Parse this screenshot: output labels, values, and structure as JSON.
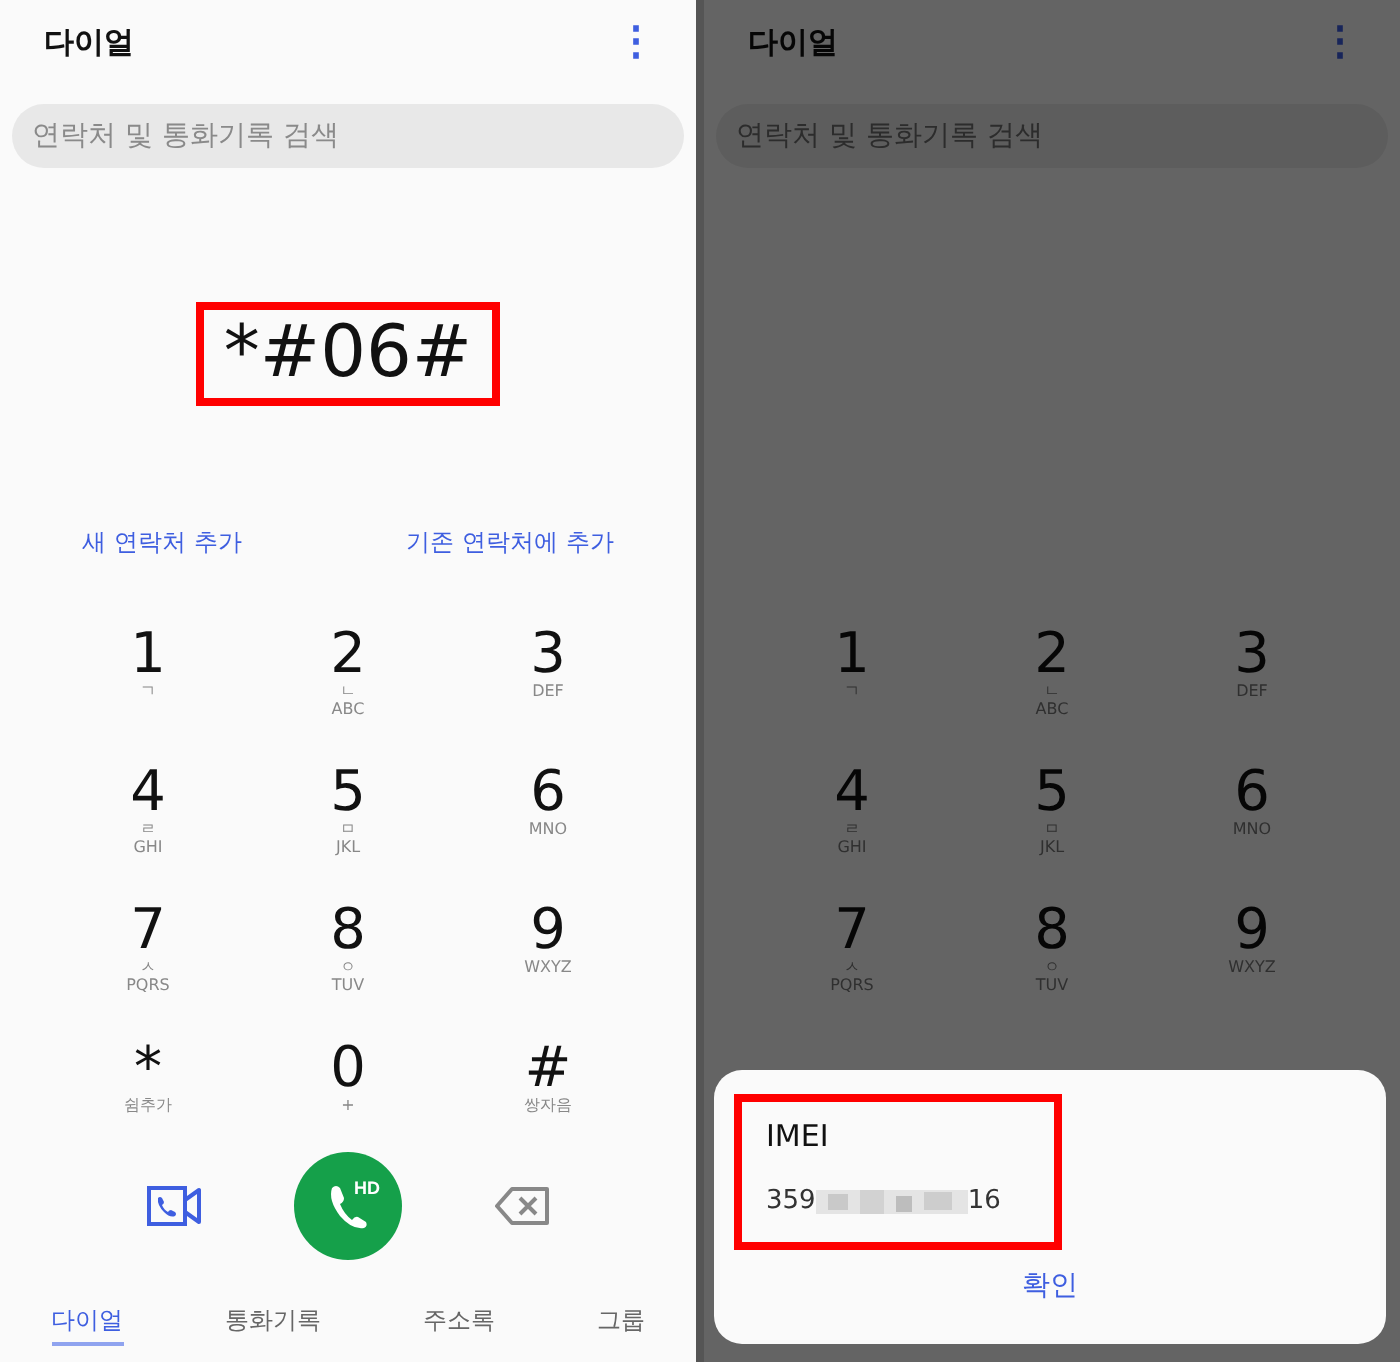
{
  "screens": [
    {
      "dimmed": false,
      "title": "다이얼",
      "menu_icon": "⋮",
      "search": {
        "placeholder": "연락처 및 통화기록 검색"
      },
      "dialed_number": {
        "text": "*#06#",
        "highlighted": true
      },
      "links": [
        "새 연락처 추가",
        "기존 연락처에 추가"
      ],
      "keypad": [
        {
          "digit": "1",
          "sub": [
            "ㄱ"
          ]
        },
        {
          "digit": "2",
          "sub": [
            "ㄴ",
            "ABC"
          ]
        },
        {
          "digit": "3",
          "sub": [
            "DEF"
          ]
        },
        {
          "digit": "4",
          "sub": [
            "ㄹ",
            "GHI"
          ]
        },
        {
          "digit": "5",
          "sub": [
            "ㅁ",
            "JKL"
          ]
        },
        {
          "digit": "6",
          "sub": [
            "MNO"
          ]
        },
        {
          "digit": "7",
          "sub": [
            "ㅅ",
            "PQRS"
          ]
        },
        {
          "digit": "8",
          "sub": [
            "ㅇ",
            "TUV"
          ]
        },
        {
          "digit": "9",
          "sub": [
            "WXYZ"
          ]
        },
        {
          "digit": "*",
          "sub": [
            "쉼추가"
          ]
        },
        {
          "digit": "0",
          "sub": [
            "+"
          ]
        },
        {
          "digit": "#",
          "sub": [
            "쌍자음"
          ]
        }
      ],
      "call_button": {
        "badge": "HD"
      },
      "tabs": [
        {
          "label": "다이얼",
          "selected": true
        },
        {
          "label": "통화기록",
          "selected": false
        },
        {
          "label": "주소록",
          "selected": false
        },
        {
          "label": "그룹",
          "selected": false
        }
      ]
    },
    {
      "dimmed": true,
      "title": "다이얼",
      "menu_icon": "⋮",
      "search": {
        "placeholder": "연락처 및 통화기록 검색"
      },
      "keypad": [
        {
          "digit": "1",
          "sub": [
            "ㄱ"
          ]
        },
        {
          "digit": "2",
          "sub": [
            "ㄴ",
            "ABC"
          ]
        },
        {
          "digit": "3",
          "sub": [
            "DEF"
          ]
        },
        {
          "digit": "4",
          "sub": [
            "ㄹ",
            "GHI"
          ]
        },
        {
          "digit": "5",
          "sub": [
            "ㅁ",
            "JKL"
          ]
        },
        {
          "digit": "6",
          "sub": [
            "MNO"
          ]
        },
        {
          "digit": "7",
          "sub": [
            "ㅅ",
            "PQRS"
          ]
        },
        {
          "digit": "8",
          "sub": [
            "ㅇ",
            "TUV"
          ]
        },
        {
          "digit": "9",
          "sub": [
            "WXYZ"
          ]
        }
      ],
      "dialog": {
        "title": "IMEI",
        "value_start": "359",
        "value_end": "16",
        "highlighted": true,
        "button": "확인"
      }
    }
  ]
}
